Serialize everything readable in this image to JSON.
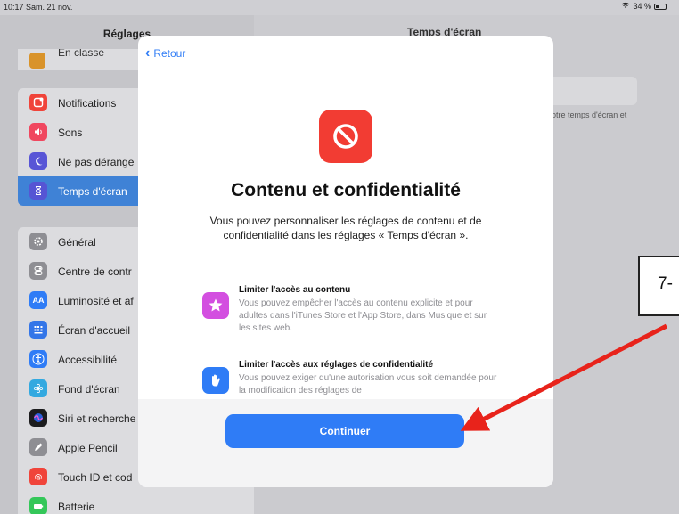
{
  "status_bar": {
    "time_date": "10:17  Sam. 21 nov.",
    "battery": "34 %"
  },
  "sidebar": {
    "title": "Réglages",
    "classroom_label": "En classe",
    "group1": [
      {
        "icon": "bell-icon",
        "color": "#f0443a",
        "label": "Notifications"
      },
      {
        "icon": "speaker-icon",
        "color": "#f0475f",
        "label": "Sons"
      },
      {
        "icon": "moon-icon",
        "color": "#5855d6",
        "label": "Ne pas dérange"
      },
      {
        "icon": "hourglass-icon",
        "color": "#5655d4",
        "label": "Temps d'écran"
      }
    ],
    "group2": [
      {
        "icon": "gear-icon",
        "color": "#8e8e93",
        "label": "Général"
      },
      {
        "icon": "toggles-icon",
        "color": "#8e8e93",
        "label": "Centre de contr"
      },
      {
        "icon": "aa-icon",
        "color": "#2f7cf6",
        "label": "Luminosité et af"
      },
      {
        "icon": "grid-icon",
        "color": "#3476e8",
        "label": "Écran d'accueil"
      },
      {
        "icon": "accessibility-icon",
        "color": "#2f7cf6",
        "label": "Accessibilité"
      },
      {
        "icon": "flower-icon",
        "color": "#33a9e0",
        "label": "Fond d'écran"
      },
      {
        "icon": "siri-icon",
        "color": "#1c1c1e",
        "label": "Siri et recherche"
      },
      {
        "icon": "pencil-icon",
        "color": "#8e8e93",
        "label": "Apple Pencil"
      },
      {
        "icon": "fingerprint-icon",
        "color": "#f0443a",
        "label": "Touch ID et cod"
      },
      {
        "icon": "battery-icon",
        "color": "#34c759",
        "label": "Batterie"
      }
    ]
  },
  "detail": {
    "title": "Temps d'écran",
    "hint": "otre temps d'écran et"
  },
  "modal": {
    "back_label": "Retour",
    "hero_icon": "restricted-icon",
    "title": "Contenu et confidentialité",
    "description": "Vous pouvez personnaliser les réglages de contenu et de confidentialité dans les réglages « Temps d'écran ».",
    "features": [
      {
        "icon": "star-icon",
        "color": "#d34fe0",
        "title": "Limiter l'accès au contenu",
        "description": "Vous pouvez empêcher l'accès au contenu explicite et pour adultes dans l'iTunes Store et l'App Store, dans Musique et sur les sites web."
      },
      {
        "icon": "hand-icon",
        "color": "#2f7cf6",
        "title": "Limiter l'accès aux réglages de confidentialité",
        "description": "Vous pouvez exiger qu'une autorisation vous soit demandée pour la modification des réglages de"
      }
    ],
    "continue_label": "Continuer"
  },
  "annotation": {
    "step_label": "7-",
    "arrow_color": "#e8231b"
  }
}
